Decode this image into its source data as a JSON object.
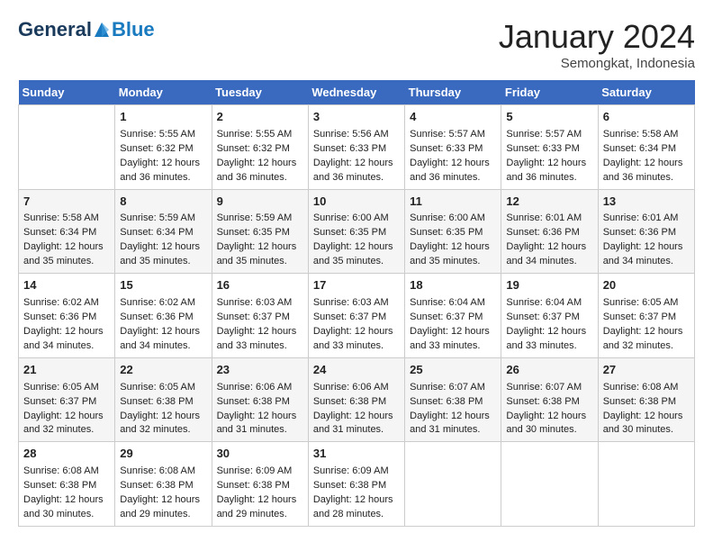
{
  "header": {
    "logo_general": "General",
    "logo_blue": "Blue",
    "month_title": "January 2024",
    "location": "Semongkat, Indonesia"
  },
  "days_of_week": [
    "Sunday",
    "Monday",
    "Tuesday",
    "Wednesday",
    "Thursday",
    "Friday",
    "Saturday"
  ],
  "weeks": [
    [
      {
        "day": "",
        "sunrise": "",
        "sunset": "",
        "daylight": ""
      },
      {
        "day": "1",
        "sunrise": "Sunrise: 5:55 AM",
        "sunset": "Sunset: 6:32 PM",
        "daylight": "Daylight: 12 hours and 36 minutes."
      },
      {
        "day": "2",
        "sunrise": "Sunrise: 5:55 AM",
        "sunset": "Sunset: 6:32 PM",
        "daylight": "Daylight: 12 hours and 36 minutes."
      },
      {
        "day": "3",
        "sunrise": "Sunrise: 5:56 AM",
        "sunset": "Sunset: 6:33 PM",
        "daylight": "Daylight: 12 hours and 36 minutes."
      },
      {
        "day": "4",
        "sunrise": "Sunrise: 5:57 AM",
        "sunset": "Sunset: 6:33 PM",
        "daylight": "Daylight: 12 hours and 36 minutes."
      },
      {
        "day": "5",
        "sunrise": "Sunrise: 5:57 AM",
        "sunset": "Sunset: 6:33 PM",
        "daylight": "Daylight: 12 hours and 36 minutes."
      },
      {
        "day": "6",
        "sunrise": "Sunrise: 5:58 AM",
        "sunset": "Sunset: 6:34 PM",
        "daylight": "Daylight: 12 hours and 36 minutes."
      }
    ],
    [
      {
        "day": "7",
        "sunrise": "Sunrise: 5:58 AM",
        "sunset": "Sunset: 6:34 PM",
        "daylight": "Daylight: 12 hours and 35 minutes."
      },
      {
        "day": "8",
        "sunrise": "Sunrise: 5:59 AM",
        "sunset": "Sunset: 6:34 PM",
        "daylight": "Daylight: 12 hours and 35 minutes."
      },
      {
        "day": "9",
        "sunrise": "Sunrise: 5:59 AM",
        "sunset": "Sunset: 6:35 PM",
        "daylight": "Daylight: 12 hours and 35 minutes."
      },
      {
        "day": "10",
        "sunrise": "Sunrise: 6:00 AM",
        "sunset": "Sunset: 6:35 PM",
        "daylight": "Daylight: 12 hours and 35 minutes."
      },
      {
        "day": "11",
        "sunrise": "Sunrise: 6:00 AM",
        "sunset": "Sunset: 6:35 PM",
        "daylight": "Daylight: 12 hours and 35 minutes."
      },
      {
        "day": "12",
        "sunrise": "Sunrise: 6:01 AM",
        "sunset": "Sunset: 6:36 PM",
        "daylight": "Daylight: 12 hours and 34 minutes."
      },
      {
        "day": "13",
        "sunrise": "Sunrise: 6:01 AM",
        "sunset": "Sunset: 6:36 PM",
        "daylight": "Daylight: 12 hours and 34 minutes."
      }
    ],
    [
      {
        "day": "14",
        "sunrise": "Sunrise: 6:02 AM",
        "sunset": "Sunset: 6:36 PM",
        "daylight": "Daylight: 12 hours and 34 minutes."
      },
      {
        "day": "15",
        "sunrise": "Sunrise: 6:02 AM",
        "sunset": "Sunset: 6:36 PM",
        "daylight": "Daylight: 12 hours and 34 minutes."
      },
      {
        "day": "16",
        "sunrise": "Sunrise: 6:03 AM",
        "sunset": "Sunset: 6:37 PM",
        "daylight": "Daylight: 12 hours and 33 minutes."
      },
      {
        "day": "17",
        "sunrise": "Sunrise: 6:03 AM",
        "sunset": "Sunset: 6:37 PM",
        "daylight": "Daylight: 12 hours and 33 minutes."
      },
      {
        "day": "18",
        "sunrise": "Sunrise: 6:04 AM",
        "sunset": "Sunset: 6:37 PM",
        "daylight": "Daylight: 12 hours and 33 minutes."
      },
      {
        "day": "19",
        "sunrise": "Sunrise: 6:04 AM",
        "sunset": "Sunset: 6:37 PM",
        "daylight": "Daylight: 12 hours and 33 minutes."
      },
      {
        "day": "20",
        "sunrise": "Sunrise: 6:05 AM",
        "sunset": "Sunset: 6:37 PM",
        "daylight": "Daylight: 12 hours and 32 minutes."
      }
    ],
    [
      {
        "day": "21",
        "sunrise": "Sunrise: 6:05 AM",
        "sunset": "Sunset: 6:37 PM",
        "daylight": "Daylight: 12 hours and 32 minutes."
      },
      {
        "day": "22",
        "sunrise": "Sunrise: 6:05 AM",
        "sunset": "Sunset: 6:38 PM",
        "daylight": "Daylight: 12 hours and 32 minutes."
      },
      {
        "day": "23",
        "sunrise": "Sunrise: 6:06 AM",
        "sunset": "Sunset: 6:38 PM",
        "daylight": "Daylight: 12 hours and 31 minutes."
      },
      {
        "day": "24",
        "sunrise": "Sunrise: 6:06 AM",
        "sunset": "Sunset: 6:38 PM",
        "daylight": "Daylight: 12 hours and 31 minutes."
      },
      {
        "day": "25",
        "sunrise": "Sunrise: 6:07 AM",
        "sunset": "Sunset: 6:38 PM",
        "daylight": "Daylight: 12 hours and 31 minutes."
      },
      {
        "day": "26",
        "sunrise": "Sunrise: 6:07 AM",
        "sunset": "Sunset: 6:38 PM",
        "daylight": "Daylight: 12 hours and 30 minutes."
      },
      {
        "day": "27",
        "sunrise": "Sunrise: 6:08 AM",
        "sunset": "Sunset: 6:38 PM",
        "daylight": "Daylight: 12 hours and 30 minutes."
      }
    ],
    [
      {
        "day": "28",
        "sunrise": "Sunrise: 6:08 AM",
        "sunset": "Sunset: 6:38 PM",
        "daylight": "Daylight: 12 hours and 30 minutes."
      },
      {
        "day": "29",
        "sunrise": "Sunrise: 6:08 AM",
        "sunset": "Sunset: 6:38 PM",
        "daylight": "Daylight: 12 hours and 29 minutes."
      },
      {
        "day": "30",
        "sunrise": "Sunrise: 6:09 AM",
        "sunset": "Sunset: 6:38 PM",
        "daylight": "Daylight: 12 hours and 29 minutes."
      },
      {
        "day": "31",
        "sunrise": "Sunrise: 6:09 AM",
        "sunset": "Sunset: 6:38 PM",
        "daylight": "Daylight: 12 hours and 28 minutes."
      },
      {
        "day": "",
        "sunrise": "",
        "sunset": "",
        "daylight": ""
      },
      {
        "day": "",
        "sunrise": "",
        "sunset": "",
        "daylight": ""
      },
      {
        "day": "",
        "sunrise": "",
        "sunset": "",
        "daylight": ""
      }
    ]
  ]
}
